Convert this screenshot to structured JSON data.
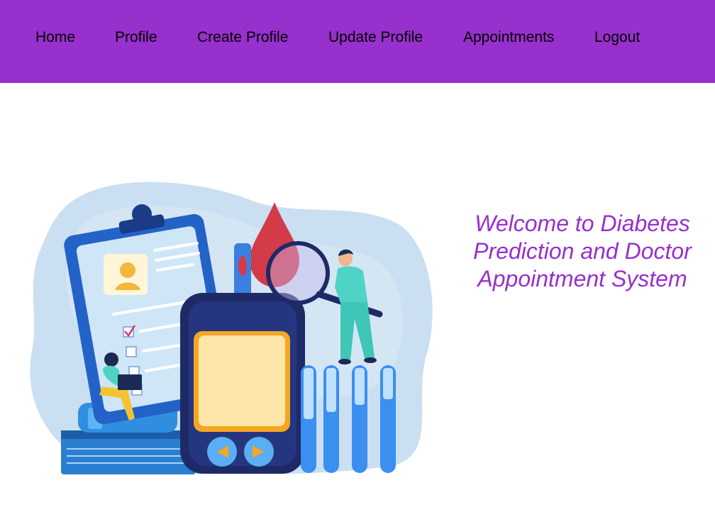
{
  "nav": {
    "items": [
      {
        "label": "Home"
      },
      {
        "label": "Profile"
      },
      {
        "label": "Create Profile"
      },
      {
        "label": "Update Profile"
      },
      {
        "label": "Appointments"
      },
      {
        "label": "Logout"
      }
    ]
  },
  "main": {
    "welcome_text": "Welcome to Diabetes Prediction and Doctor Appointment System",
    "hero_image": "diabetes-checkup-illustration"
  },
  "colors": {
    "navbar_bg": "#9730cc",
    "accent": "#9730cc",
    "text": "#000000",
    "background": "#ffffff"
  }
}
